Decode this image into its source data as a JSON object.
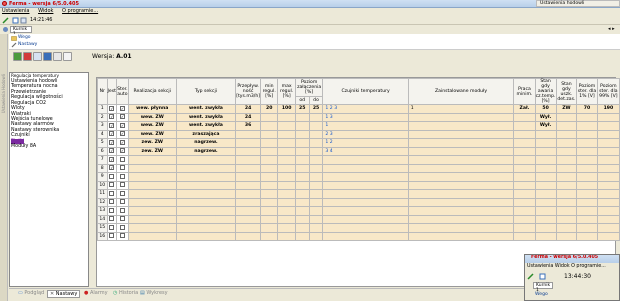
{
  "app": {
    "title": "Ferma - wersja 6/5.0.405",
    "menu": [
      "Ustawienia",
      "Widok",
      "O programie..."
    ],
    "clock": "14:21:46",
    "tab": "Kurnik 1",
    "side_tab": "Ustawienia Hodowli"
  },
  "top_right_tab": "Ustawienia hodowli",
  "breadcrumb": {
    "level1": "Wego",
    "level2": "Nastawy"
  },
  "wersja": {
    "label": "Wersja:",
    "value": "A.01"
  },
  "left_panel": {
    "items": [
      "Regulacja temperatury",
      "Ustawienia hodowli",
      "Temperatura nocna",
      "Przewietrzanie",
      "Regulacja wilgotności",
      "Regulacja CO2",
      "Wloty",
      "Wiatraki",
      "Wejścia tunelowe",
      "Nastawy alarmów",
      "Nastawy sterownika",
      "Czujniki",
      "Siatki",
      "Moduły 8A"
    ],
    "selected": 12
  },
  "table": {
    "headers": {
      "nr": "Nr",
      "jest": "Jest",
      "ster": "Ster. auto",
      "realizacja": "Realizacja sekcji",
      "typ": "Typ sekcji",
      "przeplyw": "Przepływ. ność [tys.m3/h]",
      "min": "min regul. [%]",
      "max": "max regul. [%]",
      "poziom": "Poziom załączenia [%]",
      "poziom_od": "od",
      "poziom_do": "do",
      "czujniki": "Czujniki temperatury",
      "zainstalowane": "Zainstalowane moduły",
      "praca": "Praca minim.",
      "stan_awaria": "Stan gdy awaria cz.temp. [%]",
      "stan_uszk": "Stan gdy uszk. det.zas.",
      "poziom1": "Poziom ster. dla 1% [V]",
      "poziom99": "Poziom ster. dla 99% [V]"
    },
    "rows": [
      {
        "nr": "1",
        "jest": true,
        "ster": true,
        "realizacja": "wew. płynna",
        "typ": "went. zwykła",
        "przeplyw": "24",
        "min": "20",
        "max": "100",
        "od": "25",
        "do": "25",
        "czujniki": "1 2 3",
        "moduly": "1",
        "praca": "Zał.",
        "awaria": "50",
        "uszk": "ZW",
        "v1": "70",
        "v99": "190"
      },
      {
        "nr": "2",
        "jest": true,
        "ster": true,
        "realizacja": "wew. ZW",
        "typ": "went. zwykła",
        "przeplyw": "24",
        "czujniki": "1 3",
        "awaria": "Wył."
      },
      {
        "nr": "3",
        "jest": true,
        "ster": true,
        "realizacja": "wew. ZW",
        "typ": "went. zwykła",
        "przeplyw": "36",
        "czujniki": "1",
        "awaria": "Wył."
      },
      {
        "nr": "4",
        "jest": true,
        "ster": true,
        "realizacja": "wew. ZW",
        "typ": "zraszająca",
        "czujniki": "2 3"
      },
      {
        "nr": "5",
        "jest": true,
        "ster": true,
        "realizacja": "zew. ZW",
        "typ": "nagrzew.",
        "czujniki": "1 2"
      },
      {
        "nr": "6",
        "jest": true,
        "ster": true,
        "realizacja": "zew. ZW",
        "typ": "nagrzew.",
        "czujniki": "3 4"
      },
      {
        "nr": "7",
        "jest": true,
        "ster": false
      },
      {
        "nr": "8",
        "jest": true,
        "ster": false
      },
      {
        "nr": "9",
        "jest": false,
        "ster": false
      },
      {
        "nr": "10",
        "jest": false,
        "ster": false
      },
      {
        "nr": "11",
        "jest": false,
        "ster": false
      },
      {
        "nr": "12",
        "jest": false,
        "ster": false
      },
      {
        "nr": "13",
        "jest": false,
        "ster": false
      },
      {
        "nr": "14",
        "jest": false,
        "ster": false
      },
      {
        "nr": "15",
        "jest": false,
        "ster": false
      },
      {
        "nr": "16",
        "jest": false,
        "ster": false
      }
    ]
  },
  "bottom_tabs": [
    "Podgląd",
    "Nastawy",
    "Alarmy",
    "Historia",
    "Wykresy"
  ],
  "popup": {
    "title": "Ferma - wersja 6/5.0.405",
    "menu": "Ustawienia  Widok  O programie...",
    "clock": "13:44:30",
    "tab": "Kurnik 1",
    "breadcrumb": "Wego"
  },
  "colors": {
    "selected": "#7b2aa0",
    "grid_odd": "#f8e8c8",
    "accent": "#1155cc"
  }
}
